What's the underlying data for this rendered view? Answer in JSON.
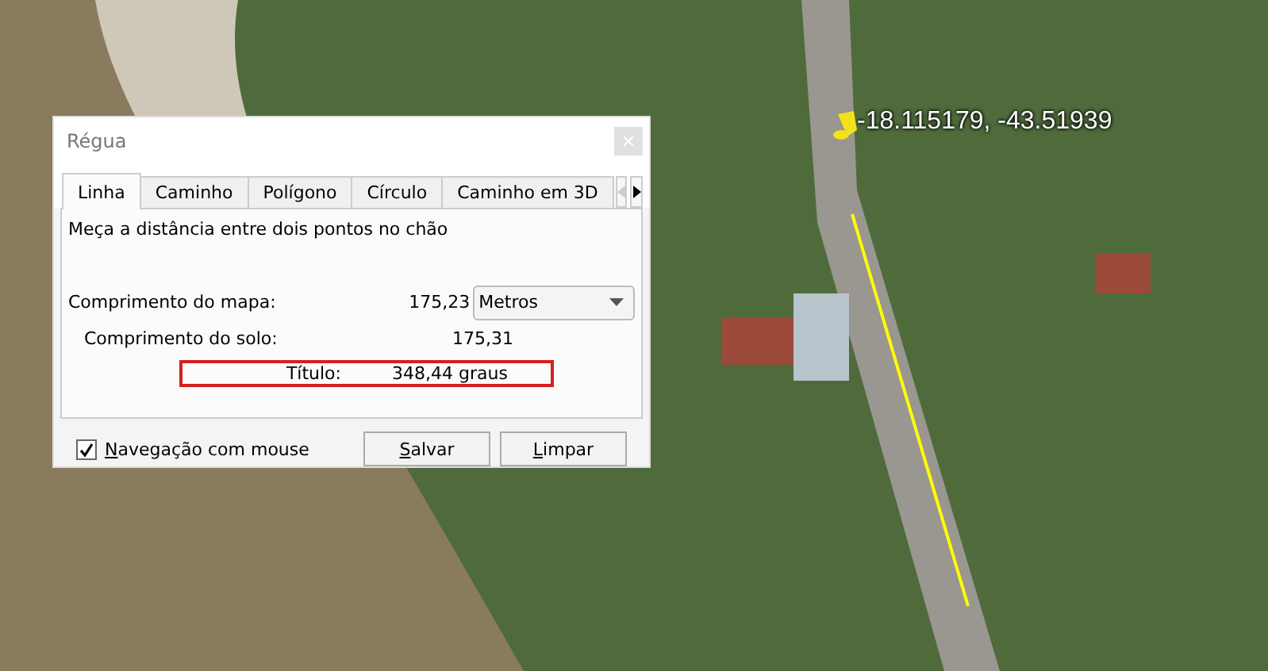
{
  "map": {
    "pin_label": "-18.115179, -43.51939"
  },
  "dialog": {
    "title": "Régua",
    "tabs": [
      {
        "label": "Linha",
        "selected": true
      },
      {
        "label": "Caminho",
        "selected": false
      },
      {
        "label": "Polígono",
        "selected": false
      },
      {
        "label": "Círculo",
        "selected": false
      },
      {
        "label": "Caminho em 3D",
        "selected": false
      }
    ],
    "tab_scroll": {
      "left_disabled": true,
      "right_disabled": false
    },
    "description": "Meça a distância entre dois pontos no chão",
    "measurements": [
      {
        "label": "Comprimento do mapa:",
        "value": "175,23",
        "highlighted": false
      },
      {
        "label": "Comprimento do solo:",
        "value": "175,31",
        "highlighted": false
      },
      {
        "label": "Título:",
        "value": "348,44 graus",
        "highlighted": true
      }
    ],
    "unit": "Metros",
    "mouse_navigation": {
      "label": "Navegação com mouse",
      "checked": true
    },
    "buttons": [
      "Salvar",
      "Limpar"
    ]
  }
}
